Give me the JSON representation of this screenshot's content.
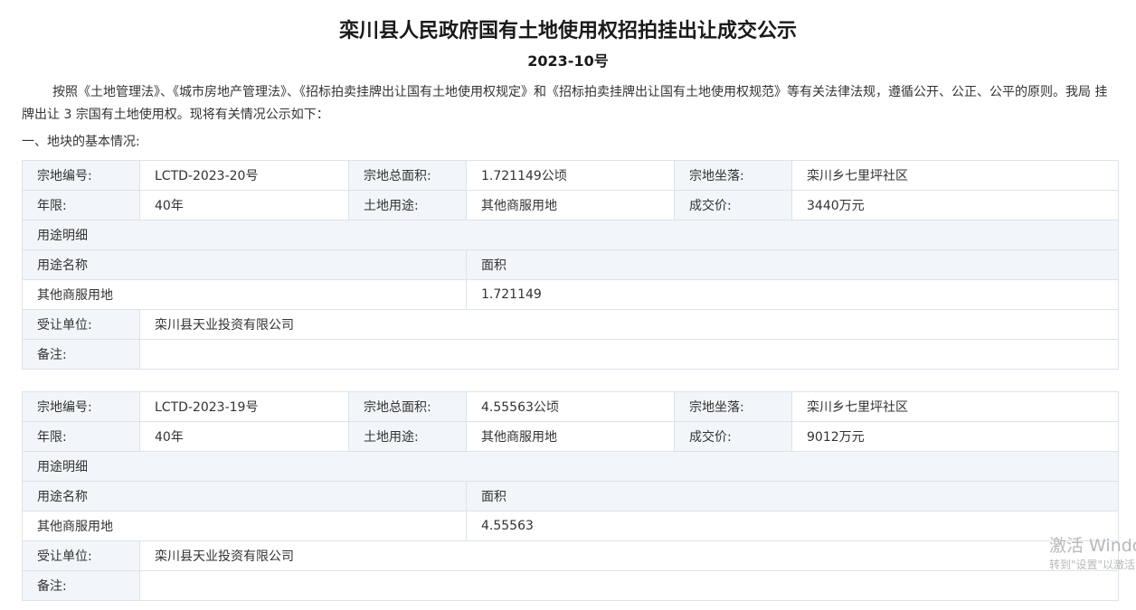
{
  "title": "栾川县人民政府国有土地使用权招拍挂出让成交公示",
  "doc_number": "2023-10号",
  "intro": "按照《土地管理法》、《城市房地产管理法》、《招标拍卖挂牌出让国有土地使用权规定》和《招标拍卖挂牌出让国有土地使用权规范》等有关法律法规，遵循公开、公正、公平的原则。我局 挂牌出让 3 宗国有土地使用权。现将有关情况公示如下：",
  "section_heading": "一、地块的基本情况:",
  "labels": {
    "parcel_no": "宗地编号:",
    "total_area": "宗地总面积:",
    "location": "宗地坐落:",
    "term": "年限:",
    "land_use": "土地用途:",
    "price": "成交价:",
    "use_detail": "用途明细",
    "use_name": "用途名称",
    "area": "面积",
    "buyer": "受让单位:",
    "remarks": "备注:"
  },
  "parcels": [
    {
      "parcel_no": "LCTD-2023-20号",
      "total_area": "1.721149公顷",
      "location": "栾川乡七里坪社区",
      "term": "40年",
      "land_use": "其他商服用地",
      "price": "3440万元",
      "use_name": "其他商服用地",
      "area": "1.721149",
      "buyer": "栾川县天业投资有限公司",
      "remarks": ""
    },
    {
      "parcel_no": "LCTD-2023-19号",
      "total_area": "4.55563公顷",
      "location": "栾川乡七里坪社区",
      "term": "40年",
      "land_use": "其他商服用地",
      "price": "9012万元",
      "use_name": "其他商服用地",
      "area": "4.55563",
      "buyer": "栾川县天业投资有限公司",
      "remarks": ""
    }
  ],
  "watermark": {
    "line1": "激活 Windows",
    "line2": "转到\"设置\"以激活 Windows。"
  }
}
